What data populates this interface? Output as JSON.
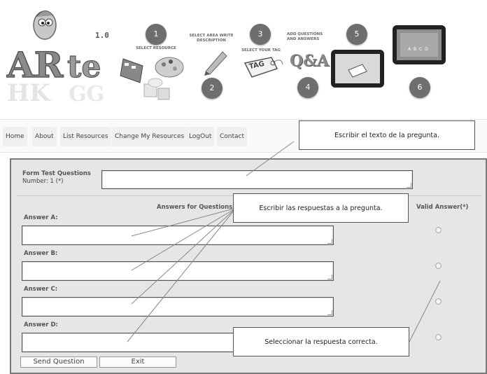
{
  "header": {
    "version": "1.0",
    "steps": [
      {
        "num": "1",
        "label": "SELECT RESOURCE"
      },
      {
        "num": "2",
        "label": "SELECT AREA WRITE DESCRIPTION"
      },
      {
        "num": "3",
        "label": "SELECT YOUR TAG"
      },
      {
        "num": "4",
        "label": "ADD QUESTIONS AND ANSWERS"
      },
      {
        "num": "5",
        "label": ""
      },
      {
        "num": "6",
        "label": ""
      }
    ],
    "tag_text": "TAG",
    "qa_text": "Q&A",
    "abcd_text": "A B C D"
  },
  "nav": {
    "items": [
      "Home",
      "About",
      "List Resources",
      "Change My Resources",
      "LogOut",
      "Contact"
    ]
  },
  "form": {
    "question_label_1": "Form Test Questions",
    "question_label_2": "Number: 1 (*)",
    "answers_header": "Answers for Questions Num",
    "valid_header": "Valid Answer(*)",
    "answers": [
      "Answer A:",
      "Answer B:",
      "Answer C:",
      "Answer D:"
    ],
    "send_button": "Send Question",
    "exit_button": "Exit"
  },
  "callouts": {
    "question": "Escribir el texto de la pregunta.",
    "answers": "Escribir las respuestas a la pregunta.",
    "correct": "Seleccionar la respuesta correcta."
  }
}
